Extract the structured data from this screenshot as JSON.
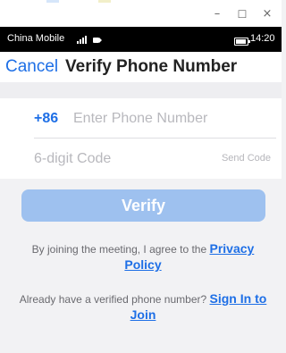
{
  "window": {
    "minimize_glyph": "–",
    "maximize_glyph": "☐",
    "close_glyph": "×"
  },
  "status_bar": {
    "carrier": "China Mobile",
    "signal": "4G",
    "time": "14:20"
  },
  "nav": {
    "cancel_label": "Cancel",
    "title": "Verify Phone Number"
  },
  "form": {
    "country_code": "+86",
    "phone_placeholder": "Enter Phone Number",
    "phone_value": "",
    "code_placeholder": "6-digit Code",
    "code_value": "",
    "send_code_label": "Send Code"
  },
  "verify_button": {
    "label": "Verify"
  },
  "privacy_notice": {
    "text": "By joining the meeting, I agree to the",
    "link": "Privacy Policy"
  },
  "signin_notice": {
    "text": "Already have a verified phone number?",
    "link": "Sign In to Join"
  },
  "colors": {
    "accent": "#1e6fe6",
    "button_disabled": "#9ec1ef",
    "background": "#f2f2f4"
  }
}
